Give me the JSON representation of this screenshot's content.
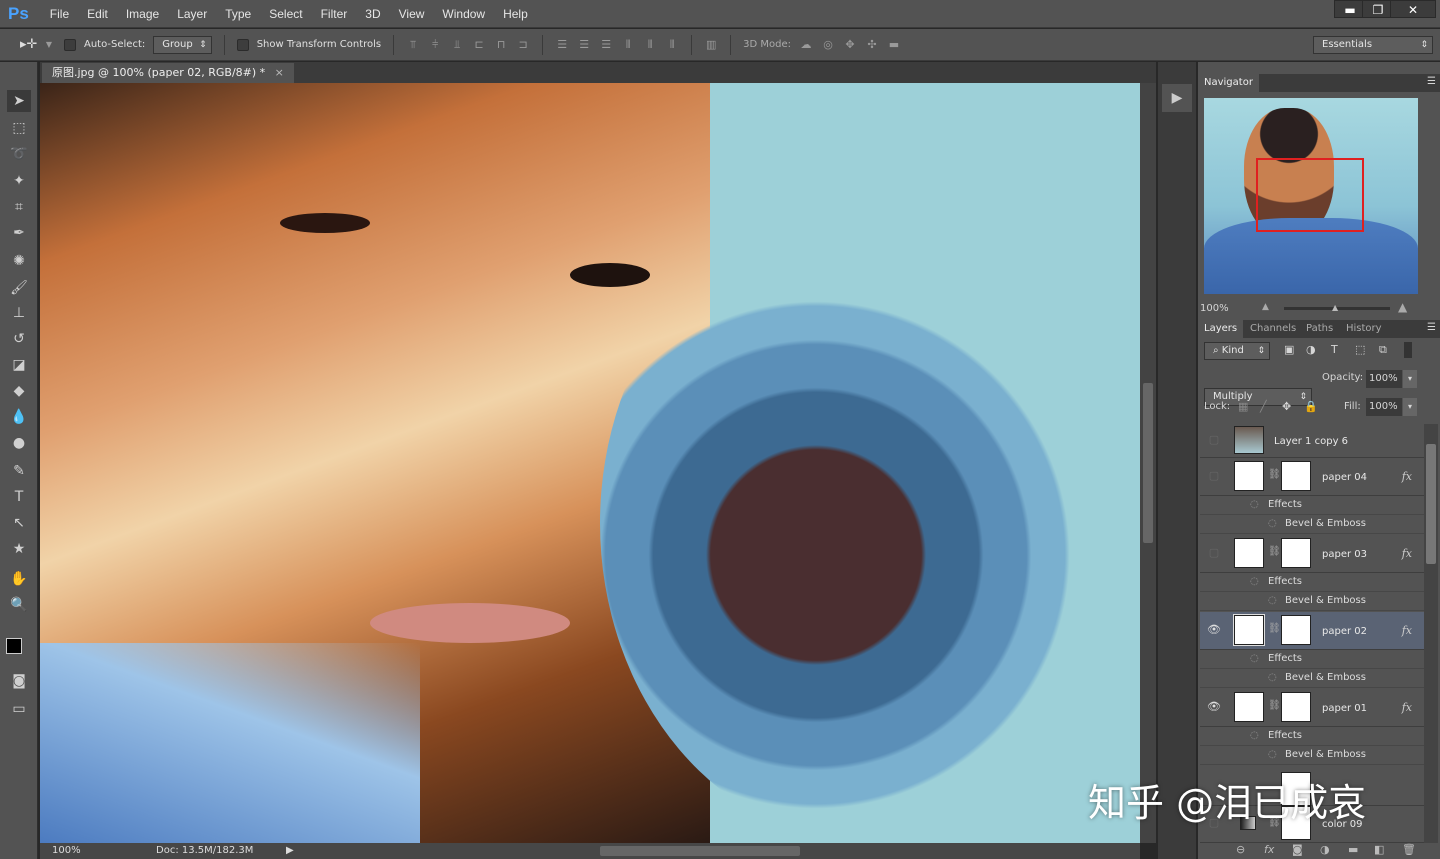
{
  "app": {
    "logo": "Ps",
    "menu": [
      "File",
      "Edit",
      "Image",
      "Layer",
      "Type",
      "Select",
      "Filter",
      "3D",
      "View",
      "Window",
      "Help"
    ],
    "window_controls": [
      "minimize",
      "restore",
      "close"
    ]
  },
  "options": {
    "auto_select_label": "Auto-Select:",
    "auto_select_value": "Group",
    "show_transform_label": "Show Transform Controls",
    "mode_3d_label": "3D Mode:",
    "workspace": "Essentials"
  },
  "document": {
    "tab_title": "原图.jpg @ 100% (paper 02, RGB/8#) *",
    "zoom": "100%",
    "doc_size": "Doc: 13.5M/182.3M"
  },
  "navigator": {
    "title": "Navigator",
    "zoom": "100%"
  },
  "layers_panel": {
    "tabs": [
      "Layers",
      "Channels",
      "Paths",
      "History"
    ],
    "filter_kind": "Kind",
    "blend_mode": "Multiply",
    "opacity_label": "Opacity:",
    "opacity": "100%",
    "lock_label": "Lock:",
    "fill_label": "Fill:",
    "fill": "100%",
    "layers": [
      {
        "name": "Layer 1 copy 6",
        "visible": false
      },
      {
        "name": "paper 04",
        "visible": false,
        "effects": "Effects",
        "effect": "Bevel & Emboss"
      },
      {
        "name": "paper 03",
        "visible": false,
        "effects": "Effects",
        "effect": "Bevel & Emboss"
      },
      {
        "name": "paper 02",
        "visible": true,
        "selected": true,
        "effects": "Effects",
        "effect": "Bevel & Emboss"
      },
      {
        "name": "paper 01",
        "visible": true,
        "effects": "Effects",
        "effect": "Bevel & Emboss"
      },
      {
        "name": "color 09",
        "visible": false
      }
    ]
  },
  "watermark": "知乎 @泪已成哀",
  "colors": {
    "accent": "#4aa3ff",
    "selected_layer": "#5a6374",
    "nav_box": "#e02020"
  }
}
